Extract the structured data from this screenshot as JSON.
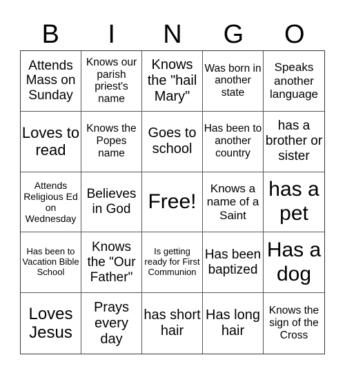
{
  "header": [
    "B",
    "I",
    "N",
    "G",
    "O"
  ],
  "cells": [
    "Attends Mass on Sunday",
    "Knows our parish priest's name",
    "Knows the \"hail Mary\"",
    "Was born in another state",
    "Speaks another language",
    "Loves to read",
    "Knows the Popes name",
    "Goes to school",
    "Has been to another country",
    "has a brother or sister",
    "Attends Religious Ed on Wednesday",
    "Believes in God",
    "Free!",
    "Knows a name of a Saint",
    "has a pet",
    "Has been to Vacation Bible School",
    "Knows the \"Our Father\"",
    "Is getting ready for First Communion",
    "Has been baptized",
    "Has a dog",
    "Loves Jesus",
    "Prays every day",
    "has short hair",
    "Has long hair",
    "Knows the sign of the Cross"
  ]
}
